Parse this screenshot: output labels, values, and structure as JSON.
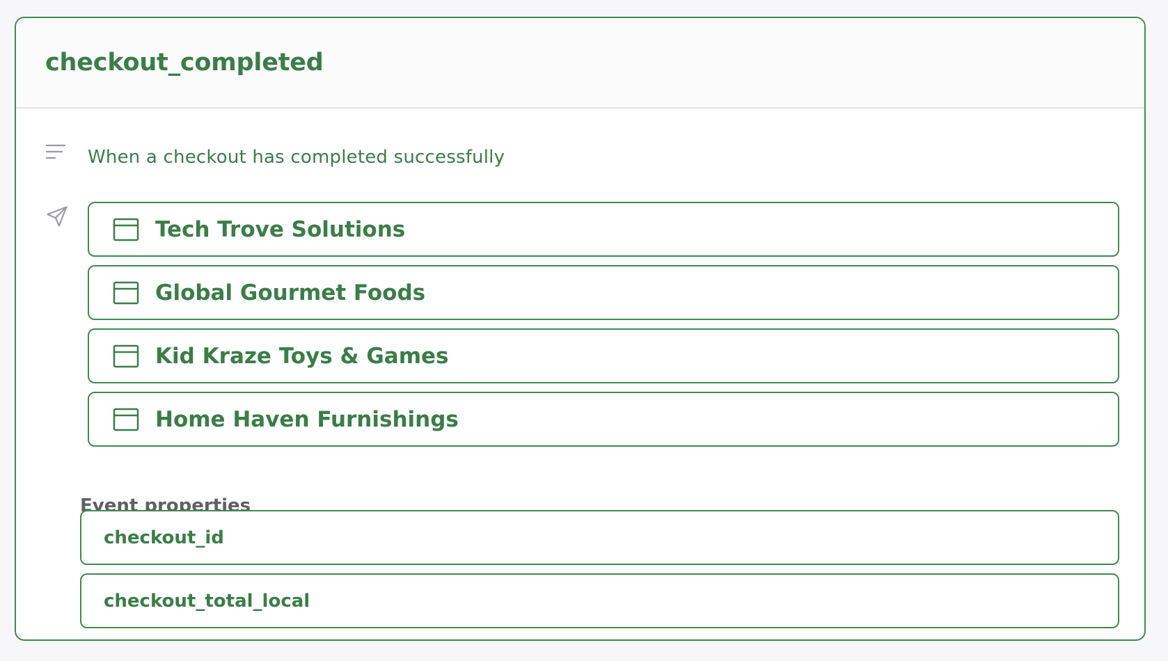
{
  "event": {
    "name": "checkout_completed",
    "description": "When a checkout has completed successfully"
  },
  "icons": {
    "description": "lines-icon",
    "destinations": "send-icon",
    "destination_item": "window-icon"
  },
  "destinations": [
    {
      "name": "Tech Trove Solutions"
    },
    {
      "name": "Global Gourmet Foods"
    },
    {
      "name": "Kid Kraze Toys & Games"
    },
    {
      "name": "Home Haven Furnishings"
    }
  ],
  "properties_section": {
    "label": "Event properties",
    "items": [
      {
        "name": "checkout_id"
      },
      {
        "name": "checkout_total_local"
      }
    ]
  },
  "colors": {
    "accent": "#3b7d48",
    "border": "#3f8a4f",
    "muted_text": "#5f5f68",
    "icon_gray": "#9a9aa2",
    "background": "#f7f7f9"
  }
}
